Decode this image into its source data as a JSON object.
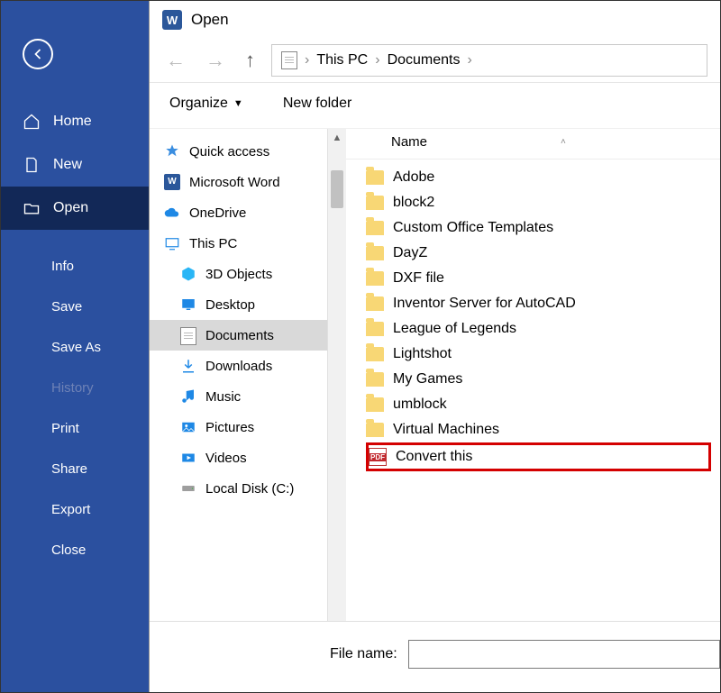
{
  "backstage": {
    "items": [
      {
        "icon": "home",
        "label": "Home"
      },
      {
        "icon": "new",
        "label": "New"
      },
      {
        "icon": "open",
        "label": "Open",
        "selected": true
      }
    ],
    "subitems": [
      {
        "label": "Info"
      },
      {
        "label": "Save"
      },
      {
        "label": "Save As"
      },
      {
        "label": "History",
        "dim": true
      },
      {
        "label": "Print"
      },
      {
        "label": "Share"
      },
      {
        "label": "Export"
      },
      {
        "label": "Close"
      }
    ]
  },
  "dialog": {
    "title": "Open",
    "breadcrumb": [
      "This PC",
      "Documents"
    ],
    "toolbar": {
      "organize": "Organize",
      "newfolder": "New folder"
    },
    "tree": [
      {
        "icon": "star",
        "label": "Quick access"
      },
      {
        "icon": "word",
        "label": "Microsoft Word"
      },
      {
        "icon": "cloud",
        "label": "OneDrive"
      },
      {
        "icon": "pc",
        "label": "This PC"
      },
      {
        "icon": "cube",
        "label": "3D Objects",
        "child": true
      },
      {
        "icon": "desktop",
        "label": "Desktop",
        "child": true
      },
      {
        "icon": "doc",
        "label": "Documents",
        "child": true,
        "selected": true
      },
      {
        "icon": "down",
        "label": "Downloads",
        "child": true
      },
      {
        "icon": "music",
        "label": "Music",
        "child": true
      },
      {
        "icon": "pic",
        "label": "Pictures",
        "child": true
      },
      {
        "icon": "video",
        "label": "Videos",
        "child": true
      },
      {
        "icon": "disk",
        "label": "Local Disk (C:)",
        "child": true
      }
    ],
    "columns": {
      "name": "Name"
    },
    "files": [
      {
        "type": "folder",
        "name": "Adobe"
      },
      {
        "type": "folder",
        "name": "block2"
      },
      {
        "type": "folder",
        "name": "Custom Office Templates"
      },
      {
        "type": "folder",
        "name": "DayZ"
      },
      {
        "type": "folder",
        "name": "DXF file"
      },
      {
        "type": "folder",
        "name": "Inventor Server for AutoCAD"
      },
      {
        "type": "folder",
        "name": "League of Legends"
      },
      {
        "type": "folder",
        "name": "Lightshot"
      },
      {
        "type": "folder",
        "name": "My Games"
      },
      {
        "type": "folder",
        "name": "umblock"
      },
      {
        "type": "folder",
        "name": "Virtual Machines"
      },
      {
        "type": "pdf",
        "name": "Convert this",
        "highlight": true
      }
    ],
    "filename_label": "File name:",
    "filename_value": ""
  }
}
